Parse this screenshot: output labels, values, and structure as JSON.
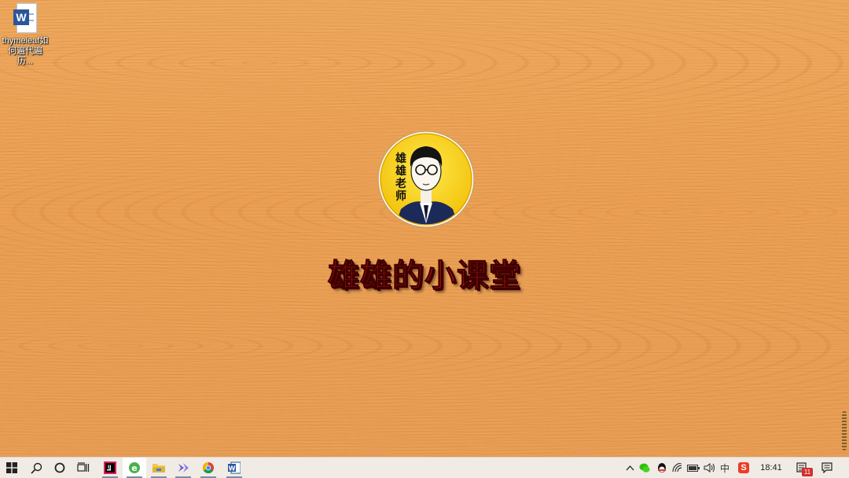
{
  "desktop": {
    "icons": [
      {
        "label_line1": "thymeleaf如",
        "label_line2": "何遍代遍历..."
      }
    ],
    "brand_title": "雄雄的小课堂",
    "logo_text": "雄雄老师"
  },
  "taskbar": {
    "start_icon": "windows-start-icon",
    "pinned_apps": [
      "search-icon",
      "cortana-icon",
      "task-view-icon",
      "intellij-idea-icon",
      "browser-e-icon",
      "file-explorer-icon",
      "dev-tool-icon",
      "chrome-icon",
      "word-icon"
    ],
    "tray": {
      "chevron": "show-hidden-icons",
      "apps": [
        "wechat-icon",
        "qq-icon",
        "wifi-icon",
        "battery-icon",
        "volume-icon",
        "ime-icon",
        "sogou-icon"
      ],
      "ime_label": "中",
      "sogou_label": "S",
      "clock": "18:41",
      "notification_count": "11"
    }
  },
  "colors": {
    "wood": "#eca256",
    "title_red": "#c81010",
    "taskbar": "#f0ebe4",
    "word_blue": "#2b579a"
  }
}
